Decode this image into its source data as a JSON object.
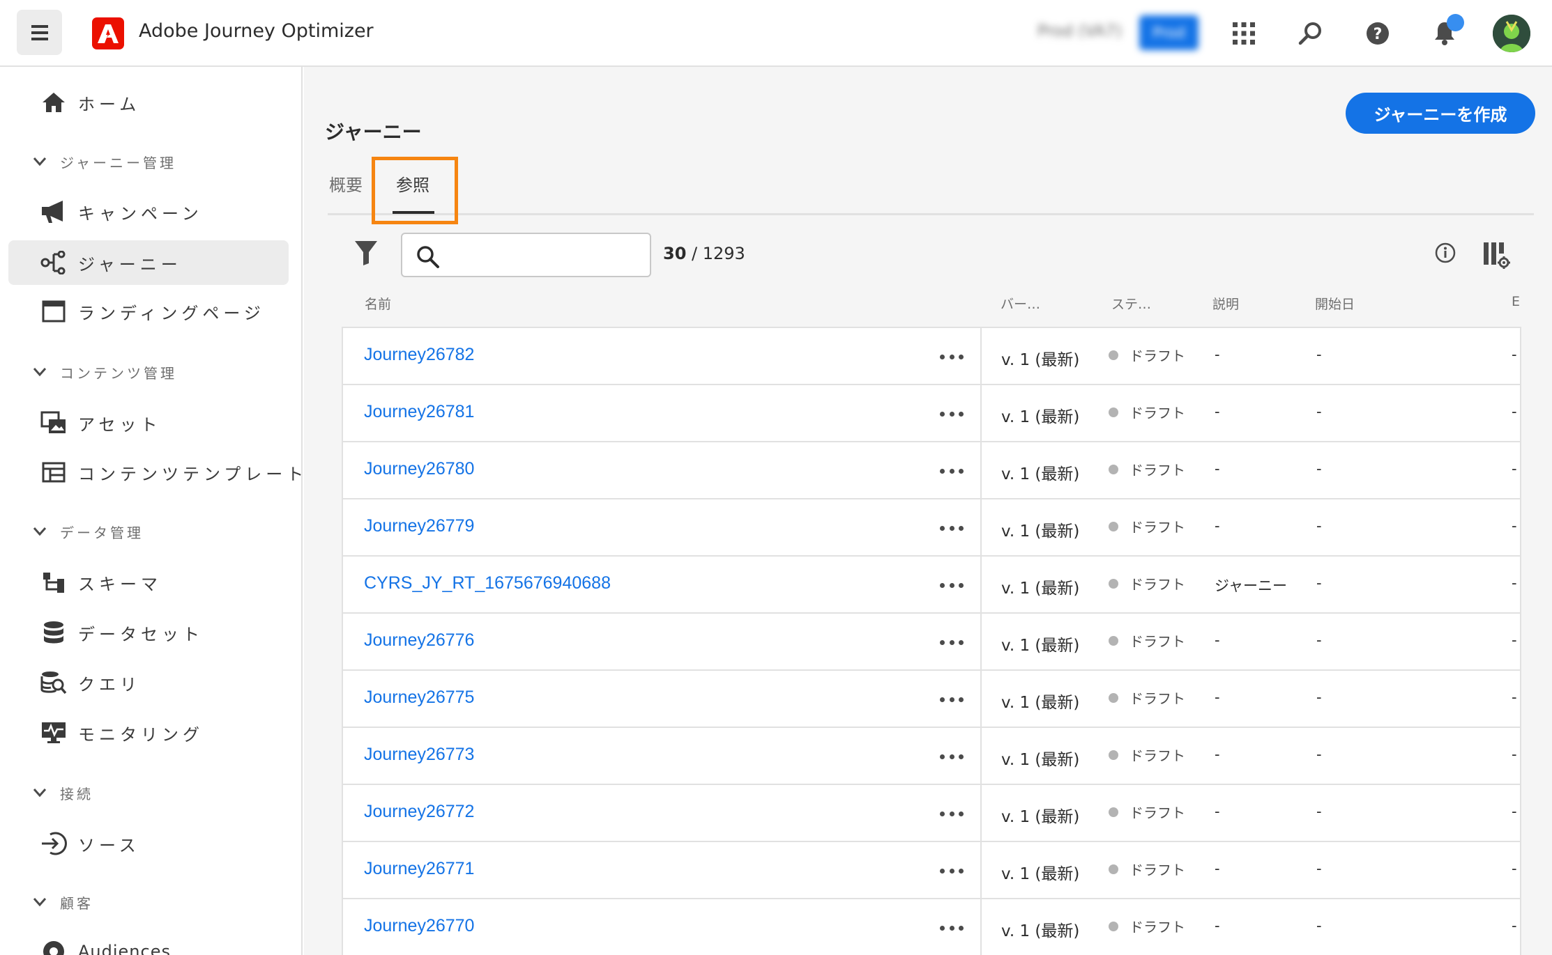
{
  "header": {
    "app_name": "Adobe Journey Optimizer",
    "env_label": "Prod (VA7)",
    "env_pill": "Prod"
  },
  "sidebar": {
    "items": [
      {
        "label": "ホーム",
        "icon": "home-icon"
      },
      {
        "label": "キャンペーン",
        "icon": "megaphone-icon"
      },
      {
        "label": "ジャーニー",
        "icon": "journey-icon"
      },
      {
        "label": "ランディングページ",
        "icon": "landing-page-icon"
      },
      {
        "label": "アセット",
        "icon": "asset-icon"
      },
      {
        "label": "コンテンツテンプレート",
        "icon": "template-icon"
      },
      {
        "label": "スキーマ",
        "icon": "schema-icon"
      },
      {
        "label": "データセット",
        "icon": "dataset-icon"
      },
      {
        "label": "クエリ",
        "icon": "query-icon"
      },
      {
        "label": "モニタリング",
        "icon": "monitoring-icon"
      },
      {
        "label": "ソース",
        "icon": "source-icon"
      },
      {
        "label": "Audiences",
        "icon": "audiences-icon"
      }
    ],
    "sections": [
      {
        "label": "ジャーニー管理"
      },
      {
        "label": "コンテンツ管理"
      },
      {
        "label": "データ管理"
      },
      {
        "label": "接続"
      },
      {
        "label": "顧客"
      }
    ]
  },
  "main": {
    "title": "ジャーニー",
    "create_button": "ジャーニーを作成",
    "tabs": [
      {
        "label": "概要"
      },
      {
        "label": "参照"
      }
    ],
    "search": {
      "placeholder": ""
    },
    "count": {
      "shown": "30",
      "total": "1293"
    },
    "columns": {
      "name": "名前",
      "version": "バー…",
      "status": "ステ…",
      "description": "説明",
      "start": "開始日",
      "end": "E"
    },
    "rows": [
      {
        "name": "Journey26782",
        "version": "v. 1 (最新)",
        "status": "ドラフト",
        "description": "-",
        "start": "-",
        "end": "-"
      },
      {
        "name": "Journey26781",
        "version": "v. 1 (最新)",
        "status": "ドラフト",
        "description": "-",
        "start": "-",
        "end": "-"
      },
      {
        "name": "Journey26780",
        "version": "v. 1 (最新)",
        "status": "ドラフト",
        "description": "-",
        "start": "-",
        "end": "-"
      },
      {
        "name": "Journey26779",
        "version": "v. 1 (最新)",
        "status": "ドラフト",
        "description": "-",
        "start": "-",
        "end": "-"
      },
      {
        "name": "CYRS_JY_RT_1675676940688",
        "version": "v. 1 (最新)",
        "status": "ドラフト",
        "description": "ジャーニー",
        "start": "-",
        "end": "-"
      },
      {
        "name": "Journey26776",
        "version": "v. 1 (最新)",
        "status": "ドラフト",
        "description": "-",
        "start": "-",
        "end": "-"
      },
      {
        "name": "Journey26775",
        "version": "v. 1 (最新)",
        "status": "ドラフト",
        "description": "-",
        "start": "-",
        "end": "-"
      },
      {
        "name": "Journey26773",
        "version": "v. 1 (最新)",
        "status": "ドラフト",
        "description": "-",
        "start": "-",
        "end": "-"
      },
      {
        "name": "Journey26772",
        "version": "v. 1 (最新)",
        "status": "ドラフト",
        "description": "-",
        "start": "-",
        "end": "-"
      },
      {
        "name": "Journey26771",
        "version": "v. 1 (最新)",
        "status": "ドラフト",
        "description": "-",
        "start": "-",
        "end": "-"
      },
      {
        "name": "Journey26770",
        "version": "v. 1 (最新)",
        "status": "ドラフト",
        "description": "-",
        "start": "-",
        "end": "-"
      }
    ]
  },
  "colors": {
    "accent": "#1473e6",
    "highlight": "#f68511",
    "draft_dot": "#b3b3b3",
    "adobe_red": "#eb1000"
  }
}
